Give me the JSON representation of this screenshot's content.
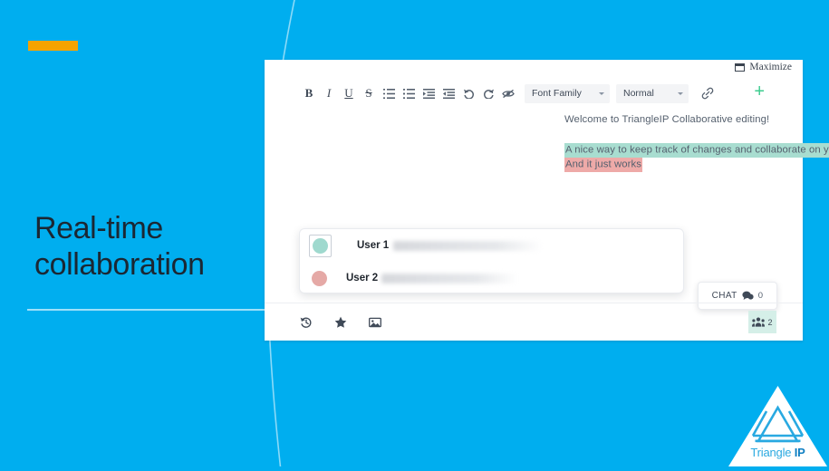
{
  "slide": {
    "background_color": "#00aeef",
    "accent_color": "#f5a300",
    "headline_line1": "Real-time",
    "headline_line2": "collaboration"
  },
  "editor": {
    "maximize_label": "Maximize",
    "toolbar": {
      "bold": "B",
      "italic": "I",
      "underline": "U",
      "strikethrough": "S",
      "ordered_list": "ordered-list-icon",
      "bullet_list": "bullet-list-icon",
      "indent": "indent-icon",
      "outdent": "outdent-icon",
      "undo": "undo-icon",
      "redo": "redo-icon",
      "clear_format": "clear-format-icon",
      "font_family": "Font Family",
      "heading_level": "Normal",
      "link": "link-icon",
      "add": "+"
    },
    "document": {
      "line1": "Welcome to TriangleIP Collaborative editing!",
      "line2": "A nice way to keep track of changes and collaborate on you ideas",
      "line2_highlight": "#a8ddd0",
      "line3": "And it just works",
      "line3_highlight": "#eeaaa8"
    },
    "users": [
      {
        "name": "User 1",
        "color": "#9fd9ce",
        "selected": true
      },
      {
        "name": "User 2",
        "color": "#e5a9a6",
        "selected": false
      }
    ],
    "bottom_toolbar": {
      "history": "history-icon",
      "star": "star-icon",
      "image": "image-icon"
    },
    "chat": {
      "label": "CHAT",
      "count": "0"
    },
    "presence": {
      "count": "2"
    }
  },
  "logo": {
    "name_light": "Triangle ",
    "name_bold": "IP"
  }
}
